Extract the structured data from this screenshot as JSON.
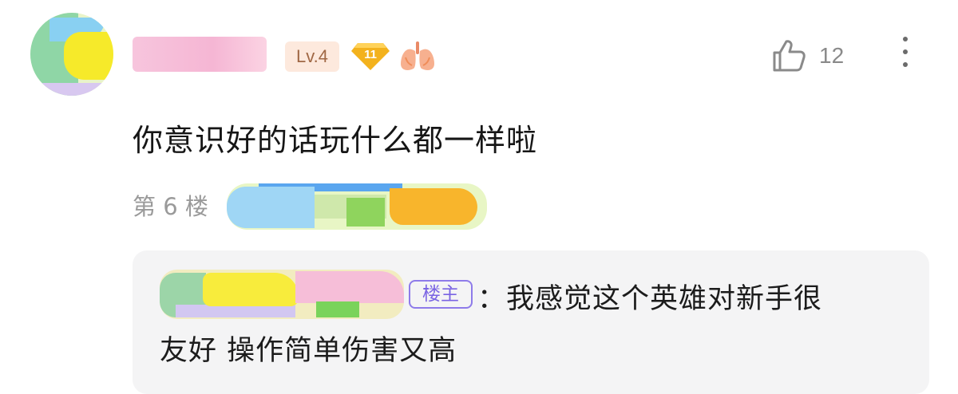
{
  "comment": {
    "level": "Lv.4",
    "gem_level": "11",
    "like_count": "12",
    "text": "你意识好的话玩什么都一样啦",
    "floor": "第 6 楼"
  },
  "reply": {
    "op_badge": "楼主",
    "text_line1": "：我感觉这个英雄对新手很",
    "text_line2": "友好 操作简单伤害又高"
  },
  "icons": {
    "like": "thumbs-up-icon",
    "more": "more-vertical-icon",
    "gem": "diamond-badge-icon",
    "lungs": "lungs-icon"
  },
  "colors": {
    "level_badge_bg": "#fde9dd",
    "level_badge_text": "#a06845",
    "gem": "#f3b21d",
    "op_badge": "#7a64e3",
    "reply_bg": "#f4f4f5"
  }
}
